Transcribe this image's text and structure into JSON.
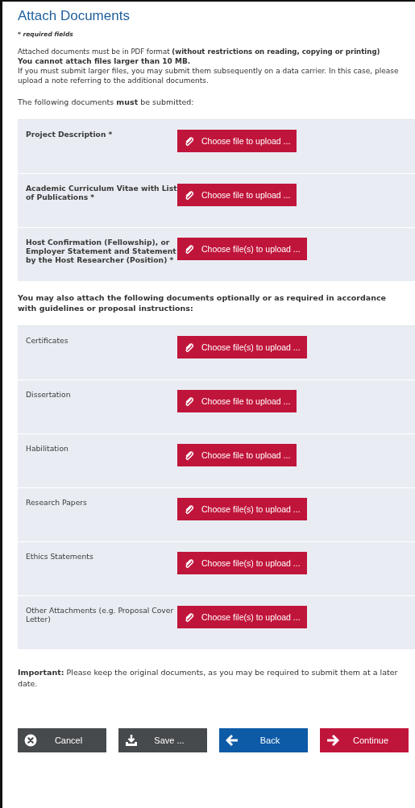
{
  "title": "Attach Documents",
  "required_note": "* required fields",
  "intro": [
    "Attached documents must be in PDF format **(without restrictions on reading, copying or printing)**",
    "**You cannot attach files larger than 10 MB.**",
    "If you must submit larger files, you may submit them subsequently on a data carrier. In this case, please upload a note referring to the additional documents."
  ],
  "required_heading": "The following documents **must** be submitted:",
  "required_documents": [
    {
      "label": "Project Description *",
      "button": "Choose file to upload ..."
    },
    {
      "label": "Academic Curriculum Vitae with List of Publications *",
      "button": "Choose file to upload ..."
    },
    {
      "label": "Host Confirmation (Fellowship), or Employer Statement and Statement by the Host Researcher (Position) *",
      "button": "Choose file(s) to upload ..."
    }
  ],
  "optional_heading": "You may also attach the following documents optionally or as required in accordance with guidelines or proposal instructions:",
  "optional_documents": [
    {
      "label": "Certificates",
      "button": "Choose file(s) to upload ..."
    },
    {
      "label": "Dissertation",
      "button": "Choose file to upload ..."
    },
    {
      "label": "Habilitation",
      "button": "Choose file to upload ..."
    },
    {
      "label": "Research Papers",
      "button": "Choose file(s) to upload ..."
    },
    {
      "label": "Ethics Statements",
      "button": "Choose file(s) to upload ..."
    },
    {
      "label": "Other Attachments (e.g. Proposal Cover Letter)",
      "button": "Choose file(s) to upload ..."
    }
  ],
  "important_note": "**Important:** Please keep the original documents, as you may be required to submit them at a later date.",
  "buttons": [
    {
      "kind": "cancel",
      "label": "Cancel"
    },
    {
      "kind": "save",
      "label": "Save ..."
    },
    {
      "kind": "back",
      "label": "Back"
    },
    {
      "kind": "continue",
      "label": "Continue"
    }
  ]
}
